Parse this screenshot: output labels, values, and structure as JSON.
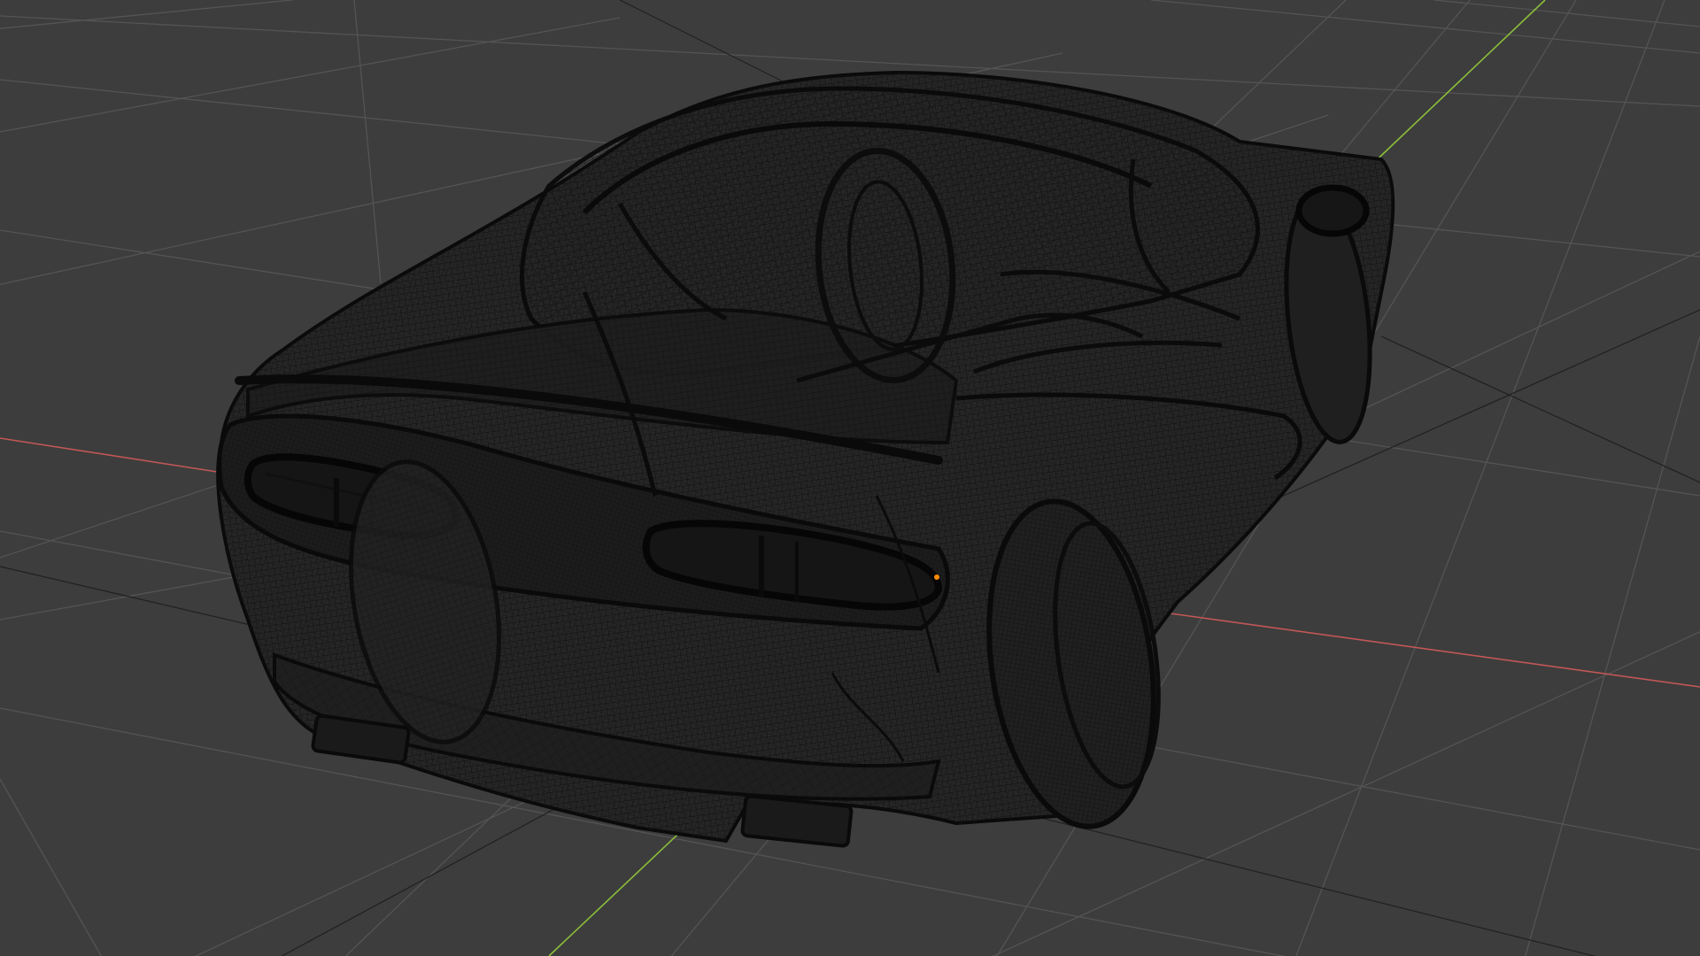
{
  "viewport": {
    "mode": "wireframe",
    "background_color": "#3d3d3d",
    "grid_color": "#555555",
    "x_axis_color": "#c25757",
    "y_axis_color": "#8cbf3a",
    "wire_color": "#0d0d0d",
    "object_origin_color": "#ff8a00",
    "object_icon": "car-wireframe-model"
  }
}
